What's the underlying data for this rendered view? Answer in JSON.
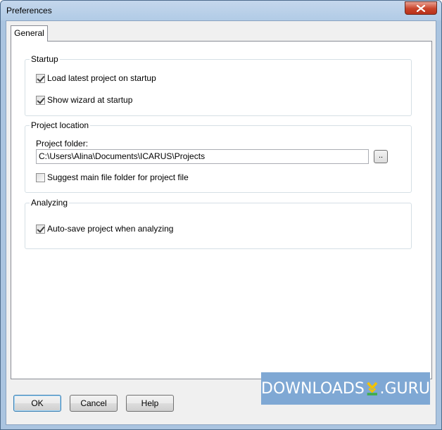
{
  "window": {
    "title": "Preferences"
  },
  "tabs": [
    {
      "label": "General",
      "selected": true
    }
  ],
  "startup": {
    "legend": "Startup",
    "load_latest": {
      "label": "Load latest project on startup",
      "checked": true
    },
    "show_wizard": {
      "label": "Show wizard at startup",
      "checked": true
    }
  },
  "project_location": {
    "legend": "Project location",
    "folder_label": "Project folder:",
    "folder_value": "C:\\Users\\Alina\\Documents\\ICARUS\\Projects",
    "browse_label": "..",
    "suggest_main": {
      "label": "Suggest main file folder for project file",
      "checked": false
    }
  },
  "analyzing": {
    "legend": "Analyzing",
    "autosave": {
      "label": "Auto-save project when analyzing",
      "checked": true
    }
  },
  "buttons": {
    "ok": "OK",
    "cancel": "Cancel",
    "help": "Help"
  },
  "watermark": {
    "left": "DOWNLOADS",
    "right": ".GURU"
  },
  "colors": {
    "accent": "#3c7fb1",
    "close": "#c9442a",
    "watermark": "#7fa8d4",
    "logo_yellow": "#f2c200",
    "logo_green": "#3fae49"
  }
}
